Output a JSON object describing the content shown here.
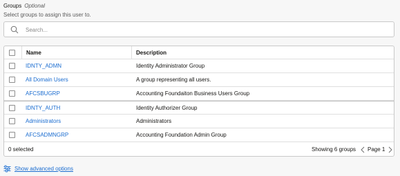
{
  "header": {
    "title": "Groups",
    "optional": "Optional",
    "subtext": "Select groups to assign this user to."
  },
  "search": {
    "placeholder": "Search..."
  },
  "table": {
    "columns": [
      "Name",
      "Description"
    ],
    "rows": [
      {
        "name": "IDNTY_ADMN",
        "description": "Identity Administrator Group"
      },
      {
        "name": "All Domain Users",
        "description": "A group representing all users."
      },
      {
        "name": "AFCSBUGRP",
        "description": "Accounting Foundaiton Business Users Group"
      },
      {
        "name": "IDNTY_AUTH",
        "description": "Identity Authorizer Group"
      },
      {
        "name": "Administrators",
        "description": "Administrators"
      },
      {
        "name": "AFCSADMNGRP",
        "description": "Accounting Foundation Admin Group"
      }
    ]
  },
  "footer": {
    "selected": "0 selected",
    "showing": "Showing 6 groups",
    "page": "Page 1"
  },
  "advanced": {
    "label": "Show advanced options"
  },
  "colors": {
    "link": "#1a6cd0",
    "border": "#c9c9c9",
    "background": "#f7f7f7"
  }
}
